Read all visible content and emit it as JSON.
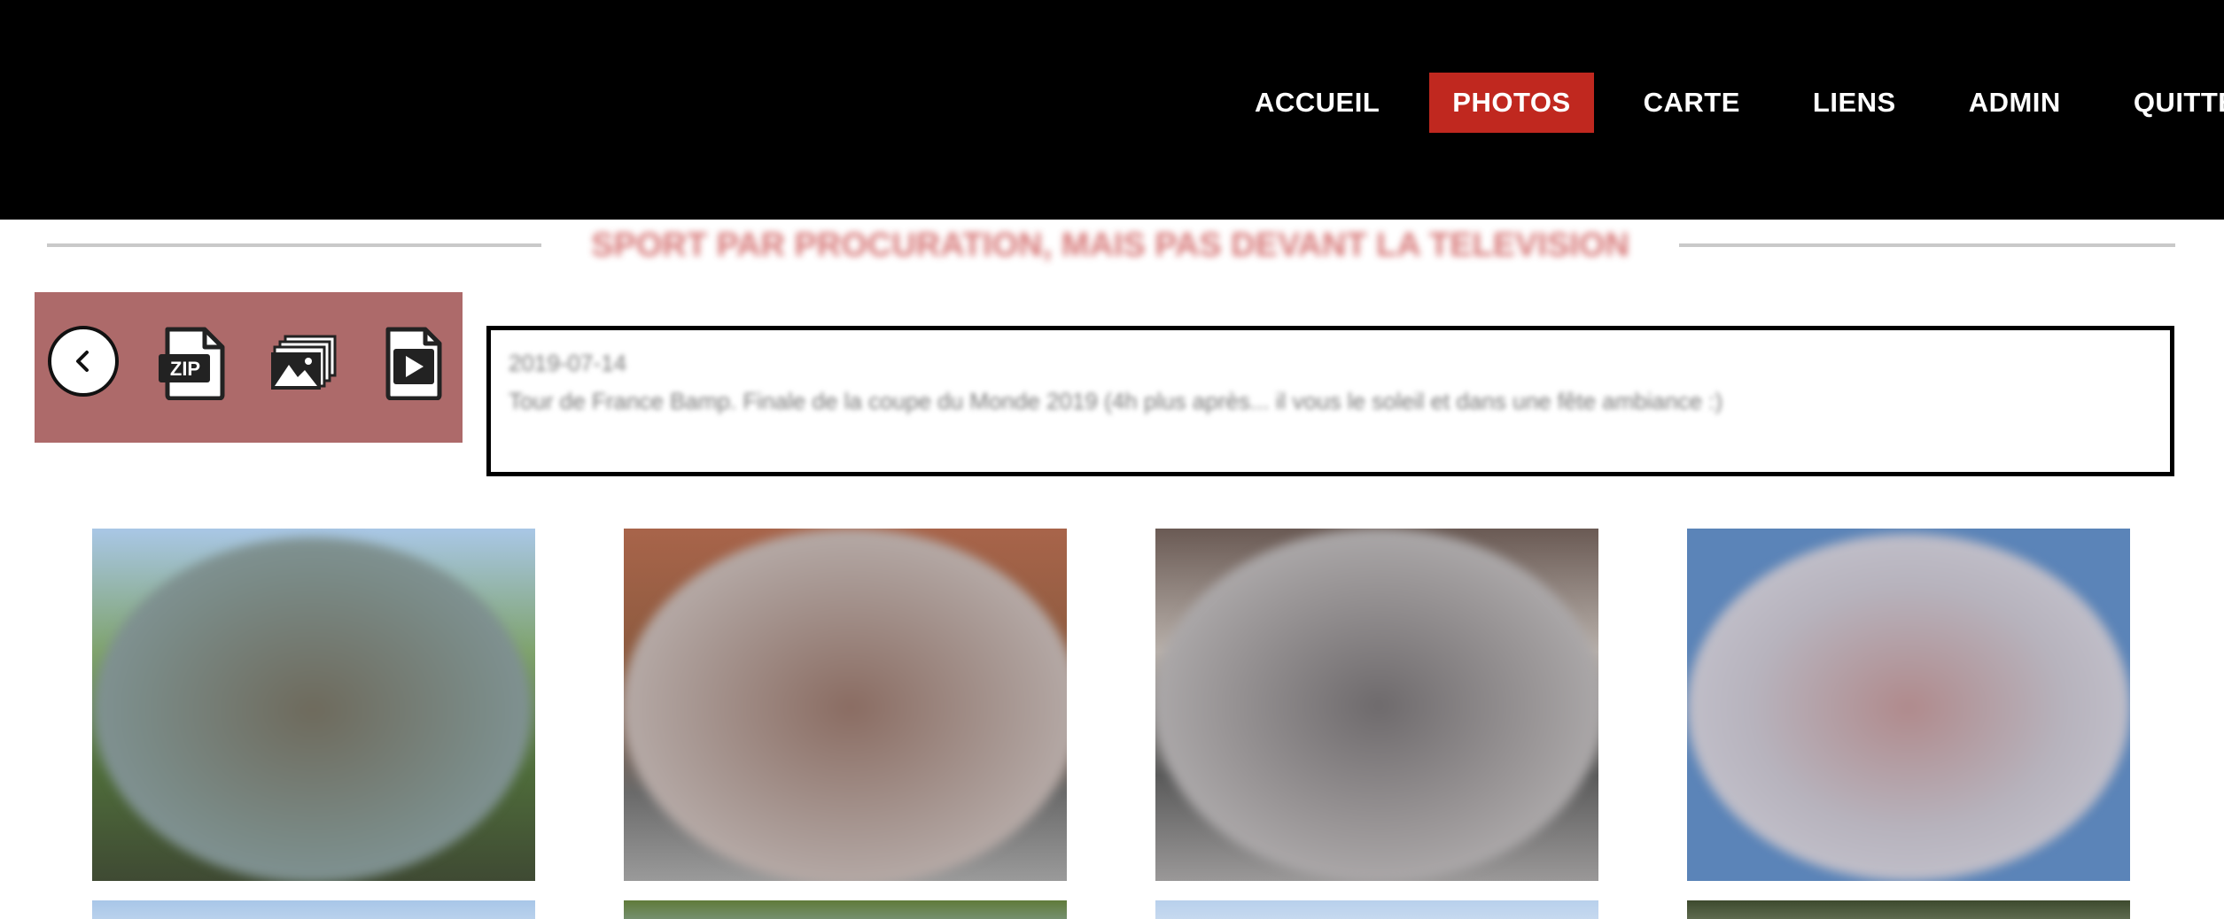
{
  "nav": {
    "items": [
      {
        "label": "ACCUEIL"
      },
      {
        "label": "PHOTOS"
      },
      {
        "label": "CARTE"
      },
      {
        "label": "LIENS"
      },
      {
        "label": "ADMIN"
      },
      {
        "label": "QUITTER"
      }
    ],
    "active_index": 1,
    "active_color": "#c0281f"
  },
  "page": {
    "title": "SPORT PAR PROCURATION, MAIS PAS DEVANT LA TELEVISION"
  },
  "toolbar": {
    "back_icon": "chevron-left-icon",
    "zip_label": "ZIP",
    "gallery_icon": "image-stack-icon",
    "play_icon": "play-document-icon",
    "background_color": "#ad6a6a"
  },
  "album": {
    "date": "2019-07-14",
    "description": "Tour de France Bamp. Finale de la coupe du Monde 2019 (4h plus après... il vous le soleil et dans une fête ambiance :)"
  }
}
